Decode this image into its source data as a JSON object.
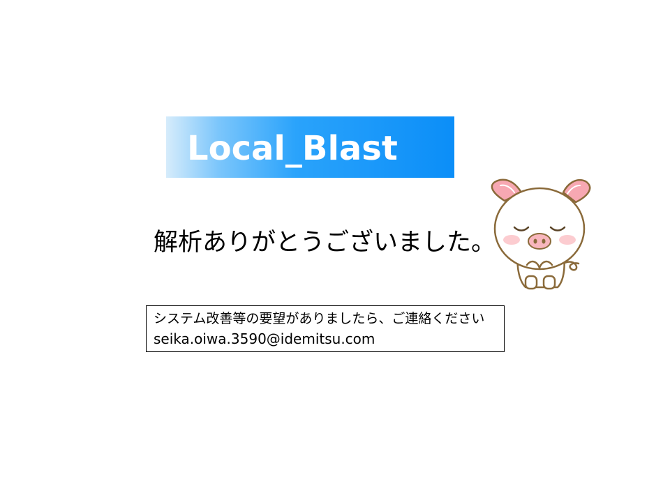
{
  "slide": {
    "title": "Local_Blast",
    "message": "解析ありがとうございました。",
    "contact": {
      "request_text": "システム改善等の要望がありましたら、ご連絡ください",
      "email": "seika.oiwa.3590@idemitsu.com"
    }
  },
  "colors": {
    "banner_start": "#d6ecfb",
    "banner_end": "#0b8ef8",
    "pig_outline": "#8a6a3a",
    "pig_ear": "#f7a8b2"
  },
  "illustration": {
    "icon": "bowing-pig-icon"
  }
}
